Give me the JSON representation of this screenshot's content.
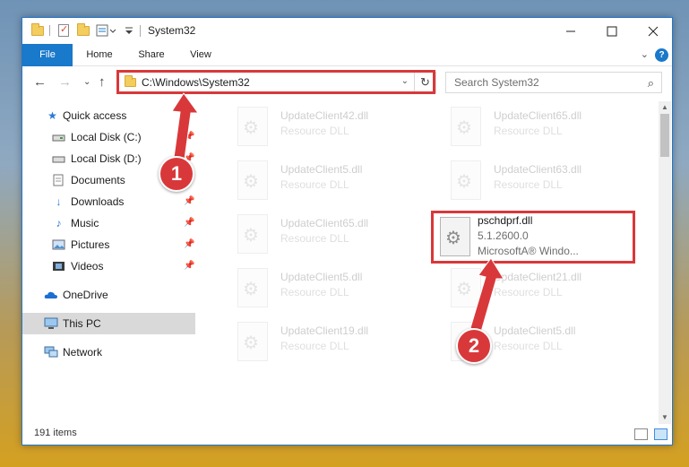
{
  "window": {
    "title": "System32"
  },
  "ribbon": {
    "tabs": [
      "File",
      "Home",
      "Share",
      "View"
    ],
    "help": "?"
  },
  "address": {
    "path": "C:\\Windows\\System32"
  },
  "search": {
    "placeholder": "Search System32"
  },
  "sidebar": {
    "items": [
      {
        "label": "Quick access"
      },
      {
        "label": "Local Disk (C:)"
      },
      {
        "label": "Local Disk (D:)"
      },
      {
        "label": "Documents"
      },
      {
        "label": "Downloads"
      },
      {
        "label": "Music"
      },
      {
        "label": "Pictures"
      },
      {
        "label": "Videos"
      },
      {
        "label": "OneDrive"
      },
      {
        "label": "This PC"
      },
      {
        "label": "Network"
      }
    ]
  },
  "files": [
    {
      "name": "UpdateClient42.dll",
      "type": "Resource DLL"
    },
    {
      "name": "UpdateClient65.dll",
      "type": "Resource DLL"
    },
    {
      "name": "UpdateClient5.dll",
      "type": "Resource DLL"
    },
    {
      "name": "UpdateClient63.dll",
      "type": "Resource DLL"
    },
    {
      "name": "UpdateClient65.dll",
      "type": "Resource DLL"
    },
    {
      "name": "pschdprf.dll",
      "version": "5.1.2600.0",
      "company": "MicrosoftA® Windo..."
    },
    {
      "name": "UpdateClient5.dll",
      "type": "Resource DLL"
    },
    {
      "name": "UpdateClient21.dll",
      "type": "Resource DLL"
    },
    {
      "name": "UpdateClient19.dll",
      "type": "Resource DLL"
    },
    {
      "name": "UpdateClient5.dll",
      "type": "Resource DLL"
    }
  ],
  "status": {
    "items": "191 items"
  },
  "badges": {
    "one": "1",
    "two": "2"
  },
  "colors": {
    "accent": "#1979ca",
    "highlight": "#d9383a"
  }
}
